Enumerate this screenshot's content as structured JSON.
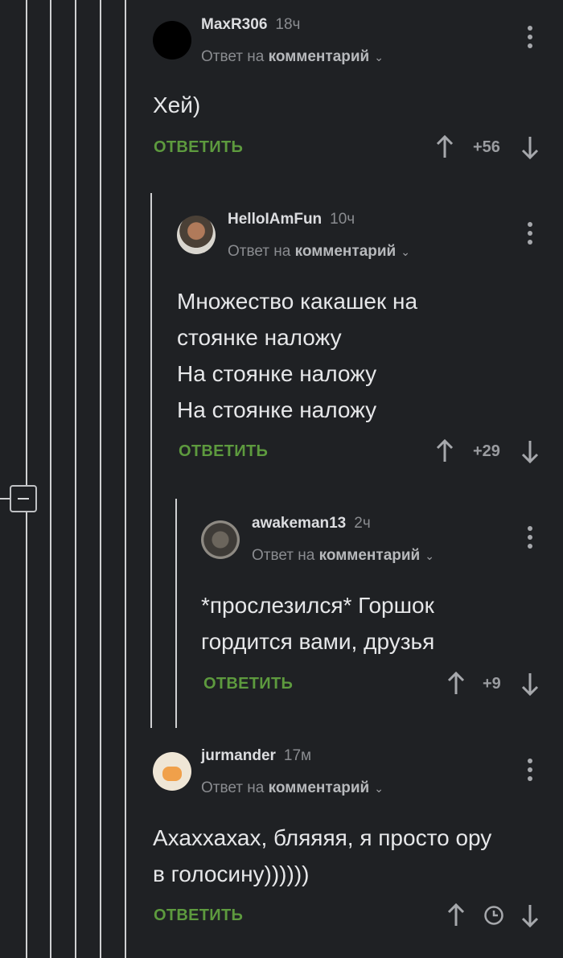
{
  "comments": [
    {
      "author": "MaxR306",
      "time": "18ч",
      "reply_prefix": "Ответ на",
      "reply_target": "комментарий",
      "lines": [
        "Хей)"
      ],
      "reply_label": "ОТВЕТИТЬ",
      "rating": "+56"
    },
    {
      "author": "HelloIAmFun",
      "time": "10ч",
      "reply_prefix": "Ответ на",
      "reply_target": "комментарий",
      "lines": [
        "Множество какашек на",
        "стоянке наложу",
        "На стоянке наложу",
        "На стоянке наложу"
      ],
      "reply_label": "ОТВЕТИТЬ",
      "rating": "+29"
    },
    {
      "author": "awakeman13",
      "time": "2ч",
      "reply_prefix": "Ответ на",
      "reply_target": "комментарий",
      "lines": [
        "*прослезился* Горшок",
        "гордится вами, друзья"
      ],
      "reply_label": "ОТВЕТИТЬ",
      "rating": "+9"
    },
    {
      "author": "jurmander",
      "time": "17м",
      "reply_prefix": "Ответ на",
      "reply_target": "комментарий",
      "lines": [
        "Ахаххахах, бляяяя, я просто ору",
        "в голосину))))))"
      ],
      "reply_label": "ОТВЕТИТЬ",
      "rating_icon": "clock-icon"
    }
  ],
  "colors": {
    "background": "#1f2124",
    "reply_green": "#5d9a3e",
    "text": "#e6e7e9",
    "muted": "#8a8c90"
  }
}
